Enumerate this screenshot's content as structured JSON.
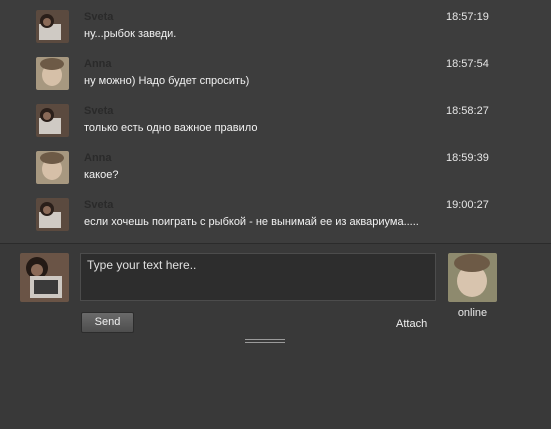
{
  "messages": [
    {
      "sender": "Sveta",
      "time": "18:57:19",
      "text": "ну...рыбок заведи."
    },
    {
      "sender": "Anna",
      "time": "18:57:54",
      "text": "ну можно) Надо будет спросить)"
    },
    {
      "sender": "Sveta",
      "time": "18:58:27",
      "text": "только есть одно важное правило"
    },
    {
      "sender": "Anna",
      "time": "18:59:39",
      "text": "какое?"
    },
    {
      "sender": "Sveta",
      "time": "19:00:27",
      "text": "если хочешь поиграть с рыбкой - не вынимай ее из аквариума....."
    }
  ],
  "composer": {
    "placeholder": "Type your text here..",
    "send_label": "Send",
    "attach_label": "Attach",
    "peer_status": "online"
  },
  "colors": {
    "background": "#393939",
    "messages_background": "#3d3d3d",
    "sender_name": "#2a2a2a"
  }
}
